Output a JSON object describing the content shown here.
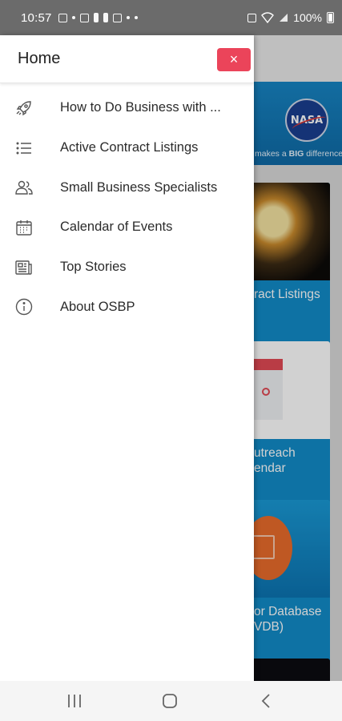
{
  "status_bar": {
    "time": "10:57",
    "battery": "100%"
  },
  "drawer": {
    "title": "Home",
    "close_label": "×",
    "items": [
      {
        "label": "How to Do Business with ...",
        "icon": "rocket-icon"
      },
      {
        "label": "Active Contract Listings",
        "icon": "list-icon"
      },
      {
        "label": "Small Business Specialists",
        "icon": "people-icon"
      },
      {
        "label": "Calendar of Events",
        "icon": "calendar-icon"
      },
      {
        "label": "Top Stories",
        "icon": "newspaper-icon"
      },
      {
        "label": "About OSBP",
        "icon": "info-icon"
      }
    ]
  },
  "background_app": {
    "logo_text": "NASA",
    "tagline_prefix": "makes a ",
    "tagline_emphasis": "BIG",
    "tagline_suffix": " difference.",
    "cards": [
      {
        "label_lines": [
          "ract Listings"
        ]
      },
      {
        "label_lines": [
          "utreach",
          "endar"
        ]
      },
      {
        "label_lines": [
          "or Database",
          "VDB)"
        ]
      }
    ]
  },
  "colors": {
    "close_button": "#eb445a",
    "status_bar": "#6b6b6b",
    "card_blue": "#128bc8"
  }
}
